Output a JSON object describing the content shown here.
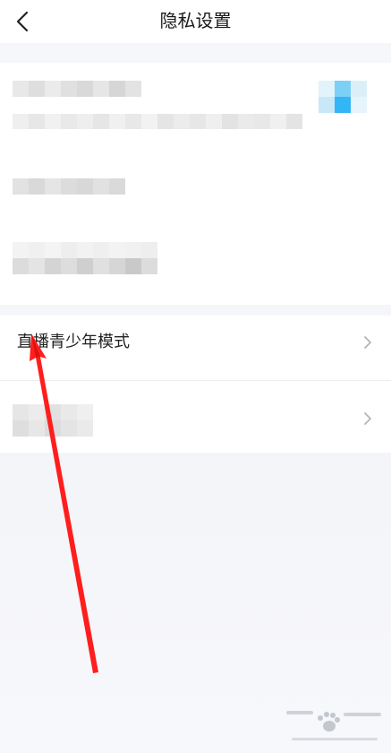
{
  "nav": {
    "title": "隐私设置",
    "back_icon": "chevron-left-icon"
  },
  "rows": [
    {
      "label": "直播青少年模式",
      "icon": "chevron-right-icon"
    }
  ],
  "colors": {
    "background": "#f4f5f9",
    "card": "#ffffff",
    "annotation_arrow": "#ff1e1e",
    "blur_accent": "#33b6f5"
  },
  "watermark": {
    "icon": "baidu-paw-icon"
  }
}
